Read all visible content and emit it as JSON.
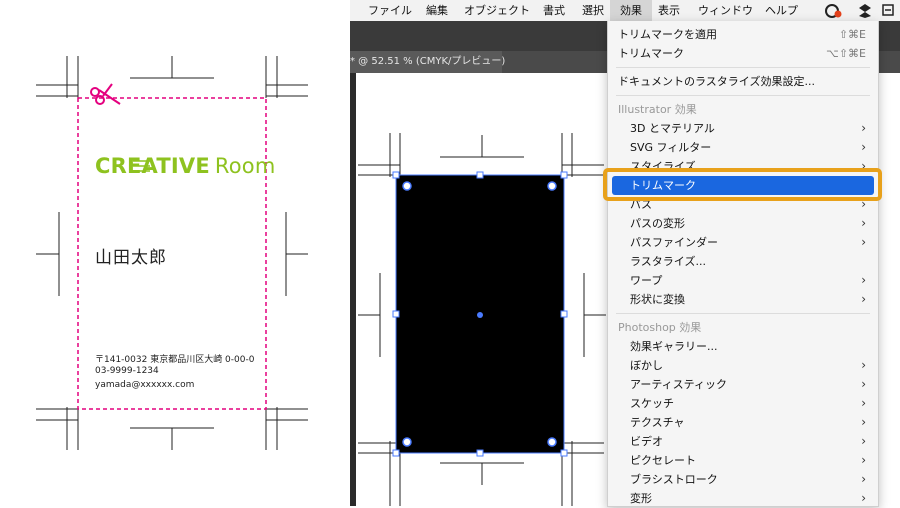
{
  "card": {
    "brand_bold": "CREATIVE",
    "brand_light": "Room",
    "name": "山田太郎",
    "address": "〒141-0032 東京都品川区大崎 0-00-0",
    "phone": "03-9999-1234",
    "email": "yamada@xxxxxx.com",
    "cut_color": "#e4007f",
    "brand_color": "#8ec21f"
  },
  "menubar": {
    "items": [
      "ファイル",
      "編集",
      "オブジェクト",
      "書式",
      "選択",
      "効果",
      "表示",
      "ウィンドウ",
      "ヘルプ"
    ],
    "active": "効果"
  },
  "document_tab": {
    "title": "* @ 52.51 % (CMYK/プレビュー)"
  },
  "effect_menu": {
    "top_items": [
      {
        "label": "トリムマークを適用",
        "shortcut": "⇧⌘E"
      },
      {
        "label": "トリムマーク",
        "shortcut": "⌥⇧⌘E"
      }
    ],
    "doc_raster": "ドキュメントのラスタライズ効果設定...",
    "illustrator_header": "Illustrator 効果",
    "illustrator_items": [
      {
        "label": "3D とマテリアル",
        "sub": true
      },
      {
        "label": "SVG フィルター",
        "sub": true
      },
      {
        "label": "スタイライズ",
        "sub": true
      },
      {
        "label": "トリムマーク",
        "sub": false,
        "selected": true
      },
      {
        "label": "パス",
        "sub": true
      },
      {
        "label": "パスの変形",
        "sub": true
      },
      {
        "label": "パスファインダー",
        "sub": true
      },
      {
        "label": "ラスタライズ...",
        "sub": false
      },
      {
        "label": "ワープ",
        "sub": true
      },
      {
        "label": "形状に変換",
        "sub": true
      }
    ],
    "photoshop_header": "Photoshop 効果",
    "photoshop_items": [
      {
        "label": "効果ギャラリー...",
        "sub": false
      },
      {
        "label": "ぼかし",
        "sub": true
      },
      {
        "label": "アーティスティック",
        "sub": true
      },
      {
        "label": "スケッチ",
        "sub": true
      },
      {
        "label": "テクスチャ",
        "sub": true
      },
      {
        "label": "ビデオ",
        "sub": true
      },
      {
        "label": "ピクセレート",
        "sub": true
      },
      {
        "label": "ブラシストローク",
        "sub": true
      },
      {
        "label": "変形",
        "sub": true
      }
    ],
    "highlight_color": "#1a67e0",
    "callout_color": "#e8a11b"
  }
}
